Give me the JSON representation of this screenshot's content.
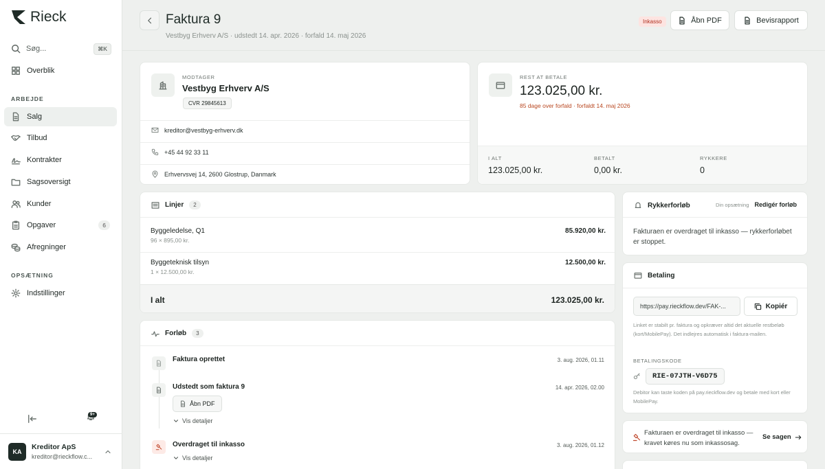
{
  "brand": {
    "name": "Rieck"
  },
  "search": {
    "placeholder": "Søg...",
    "shortcut": "⌘K"
  },
  "nav": {
    "overview": "Overblik",
    "section_work": "ARBEJDE",
    "items": [
      {
        "label": "Salg",
        "icon": "document-icon"
      },
      {
        "label": "Tilbud",
        "icon": "handshake-icon"
      },
      {
        "label": "Kontrakter",
        "icon": "signature-icon"
      },
      {
        "label": "Sagsoversigt",
        "icon": "folder-icon"
      },
      {
        "label": "Kunder",
        "icon": "users-icon"
      },
      {
        "label": "Opgaver",
        "icon": "clipboard-icon",
        "count": "6"
      },
      {
        "label": "Afregninger",
        "icon": "coins-icon"
      }
    ],
    "section_setup": "OPSÆTNING",
    "settings": "Indstillinger",
    "notifications_badge": "9+"
  },
  "user": {
    "initials": "KA",
    "name": "Kreditor ApS",
    "email": "kreditor@rieckflow.c..."
  },
  "header": {
    "title": "Faktura 9",
    "subtitle": "Vestbyg Erhverv A/S · udstedt 14. apr. 2026 · forfald 14. maj 2026",
    "status_tag": "Inkasso",
    "open_pdf": "Åbn PDF",
    "evidence_report": "Bevisrapport"
  },
  "recipient": {
    "label": "MODTAGER",
    "name": "Vestbyg Erhverv A/S",
    "cvr": "CVR 29845613",
    "email": "kreditor@vestbyg-erhverv.dk",
    "phone": "+45 44 92 33 11",
    "address": "Erhvervsvej 14, 2600 Glostrup, Danmark"
  },
  "balance": {
    "label": "REST AT BETALE",
    "amount": "123.025,00 kr.",
    "overdue": "85 dage over forfald · forfaldt 14. maj 2026",
    "total_label": "I ALT",
    "total": "123.025,00 kr.",
    "paid_label": "BETALT",
    "paid": "0,00 kr.",
    "reminders_label": "RYKKERE",
    "reminders": "0",
    "overdue_color": "#b8461f"
  },
  "lines": {
    "title": "Linjer",
    "count": "2",
    "items": [
      {
        "name": "Byggeledelse, Q1",
        "detail": "96 × 895,00 kr.",
        "amount": "85.920,00 kr."
      },
      {
        "name": "Byggeteknisk tilsyn",
        "detail": "1 × 12.500,00 kr.",
        "amount": "12.500,00 kr."
      }
    ],
    "total_label": "I alt",
    "total": "123.025,00 kr."
  },
  "timeline": {
    "title": "Forløb",
    "count": "3",
    "events": [
      {
        "title": "Faktura oprettet",
        "time": "3. aug. 2026, 01.11",
        "icon": "document-icon"
      },
      {
        "title": "Udstedt som faktura 9",
        "time": "14. apr. 2026, 02.00",
        "icon": "document-icon",
        "button": "Åbn PDF",
        "details": "Vis detaljer"
      },
      {
        "title": "Overdraget til inkasso",
        "time": "3. aug. 2026, 01.12",
        "icon": "gavel-icon",
        "details": "Vis detaljer"
      }
    ]
  },
  "dunning": {
    "title": "Rykkerforløb",
    "setup_label": "Din opsætning",
    "edit": "Redigér forløb",
    "text": "Fakturaen er overdraget til inkasso — rykkerforløbet er stoppet."
  },
  "payment": {
    "title": "Betaling",
    "link": "https://pay.rieckflow.dev/FAK-...",
    "copy": "Kopiér",
    "link_note": "Linket er stabilt pr. faktura og opkræver altid det aktuelle restbeløb (kort/MobilePay). Det indlejres automatisk i faktura-mailen.",
    "code_label": "BETALINGSKODE",
    "code": "RIE-07JTH-V6D75",
    "code_note": "Debitor kan taste koden på pay.rieckflow.dev og betale med kort eller MobilePay."
  },
  "collection": {
    "text": "Fakturaen er overdraget til inkasso — kravet køres nu som inkassosag.",
    "link": "Se sagen"
  }
}
